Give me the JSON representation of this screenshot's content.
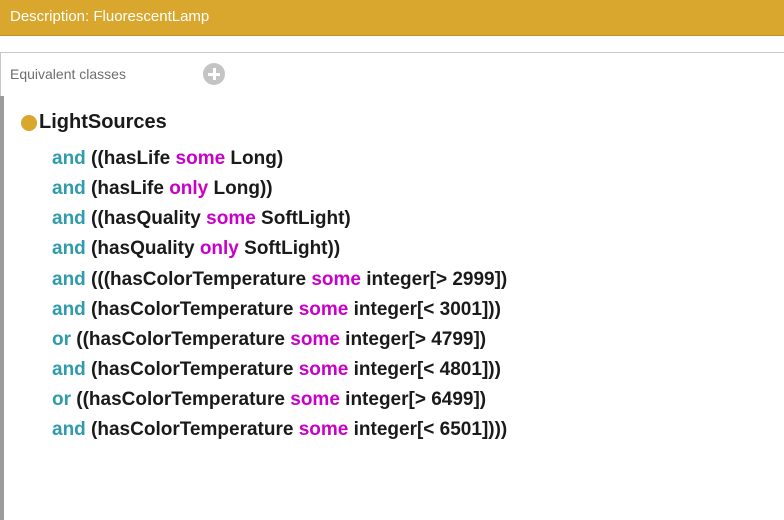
{
  "panel": {
    "title": "Description: FluorescentLamp",
    "colors": {
      "title_bar": "#d9a72e",
      "connector_keyword": "#2f9bad",
      "restriction_keyword": "#c800c8",
      "class_dot": "#d9a72e"
    }
  },
  "section": {
    "label": "Equivalent classes",
    "add_icon": "plus-circle-icon"
  },
  "expression": {
    "class_name": "LightSources",
    "lines": [
      {
        "connector": "and",
        "before": " ((hasLife ",
        "keyword": "some",
        "after": " Long)"
      },
      {
        "connector": "and",
        "before": " (hasLife ",
        "keyword": "only",
        "after": " Long))"
      },
      {
        "connector": "and",
        "before": " ((hasQuality ",
        "keyword": "some",
        "after": " SoftLight)"
      },
      {
        "connector": "and",
        "before": " (hasQuality ",
        "keyword": "only",
        "after": " SoftLight))"
      },
      {
        "connector": "and",
        "before": " (((hasColorTemperature ",
        "keyword": "some",
        "after": " integer[> 2999])"
      },
      {
        "connector": "and",
        "before": " (hasColorTemperature ",
        "keyword": "some",
        "after": " integer[< 3001]))"
      },
      {
        "connector": "or",
        "before": " ((hasColorTemperature ",
        "keyword": "some",
        "after": " integer[> 4799])"
      },
      {
        "connector": "and",
        "before": " (hasColorTemperature ",
        "keyword": "some",
        "after": " integer[< 4801]))"
      },
      {
        "connector": "or",
        "before": " ((hasColorTemperature ",
        "keyword": "some",
        "after": " integer[> 6499])"
      },
      {
        "connector": "and",
        "before": " (hasColorTemperature ",
        "keyword": "some",
        "after": " integer[< 6501])))"
      }
    ]
  }
}
